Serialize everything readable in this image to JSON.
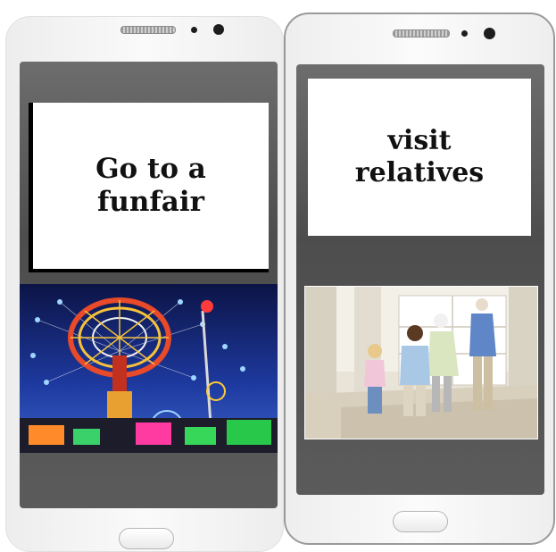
{
  "cards": [
    {
      "text": "Go to a\nfunfair",
      "photo_icon": "funfair-swing-ride-photo"
    },
    {
      "text": "visit\nrelatives",
      "photo_icon": "family-greeting-photo"
    }
  ],
  "colors": {
    "screen": "#5b5b5b",
    "card": "#ffffff",
    "text": "#111111",
    "night_sky": "#14206b",
    "ride_red": "#d23a2a"
  }
}
